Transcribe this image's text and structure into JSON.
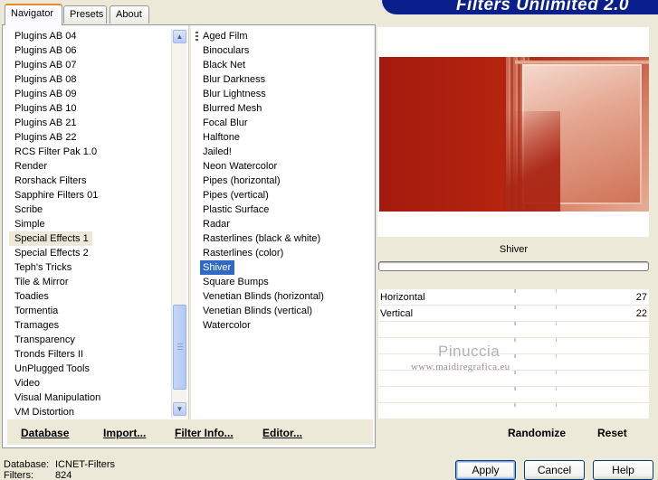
{
  "window": {
    "title": "Filters Unlimited 2.0"
  },
  "tabs": [
    {
      "label": "Navigator",
      "active": true
    },
    {
      "label": "Presets",
      "active": false
    },
    {
      "label": "About",
      "active": false
    }
  ],
  "categories": {
    "items": [
      "Plugins AB 04",
      "Plugins AB 06",
      "Plugins AB 07",
      "Plugins AB 08",
      "Plugins AB 09",
      "Plugins AB 10",
      "Plugins AB 21",
      "Plugins AB 22",
      "RCS Filter Pak 1.0",
      "Render",
      "Rorshack Filters",
      "Sapphire Filters 01",
      "Scribe",
      "Simple",
      "Special Effects 1",
      "Special Effects 2",
      "Teph's Tricks",
      "Tile & Mirror",
      "Toadies",
      "Tormentia",
      "Tramages",
      "Transparency",
      "Tronds Filters II",
      "UnPlugged Tools",
      "Video",
      "Visual Manipulation",
      "VM Distortion"
    ],
    "selected": "Special Effects 1"
  },
  "filters": {
    "items": [
      "Aged Film",
      "Binoculars",
      "Black Net",
      "Blur Darkness",
      "Blur Lightness",
      "Blurred Mesh",
      "Focal Blur",
      "Halftone",
      "Jailed!",
      "Neon Watercolor",
      "Pipes (horizontal)",
      "Pipes (vertical)",
      "Plastic Surface",
      "Radar",
      "Rasterlines (black & white)",
      "Rasterlines (color)",
      "Shiver",
      "Square Bumps",
      "Venetian Blinds (horizontal)",
      "Venetian Blinds (vertical)",
      "Watercolor"
    ],
    "selected": "Shiver"
  },
  "left_buttons": {
    "database": "Database",
    "import": "Import...",
    "filter_info": "Filter Info...",
    "editor": "Editor..."
  },
  "preview": {
    "filter_name": "Shiver",
    "progress_fraction": 0
  },
  "params": [
    {
      "label": "Horizontal",
      "value": "27"
    },
    {
      "label": "Vertical",
      "value": "22"
    }
  ],
  "watermark": {
    "name": "Pinuccia",
    "site": "www.maidiregrafica.eu"
  },
  "right_buttons": {
    "randomize": "Randomize",
    "reset": "Reset"
  },
  "status": {
    "database_label": "Database:",
    "database_value": "ICNET-Filters",
    "filters_label": "Filters:",
    "filters_value": "824"
  },
  "dialog_buttons": {
    "apply": "Apply",
    "cancel": "Cancel",
    "help": "Help"
  },
  "colors": {
    "selection": "#316ac5",
    "banner": "#0a1f8c",
    "dialog_bg": "#ece9d8"
  }
}
